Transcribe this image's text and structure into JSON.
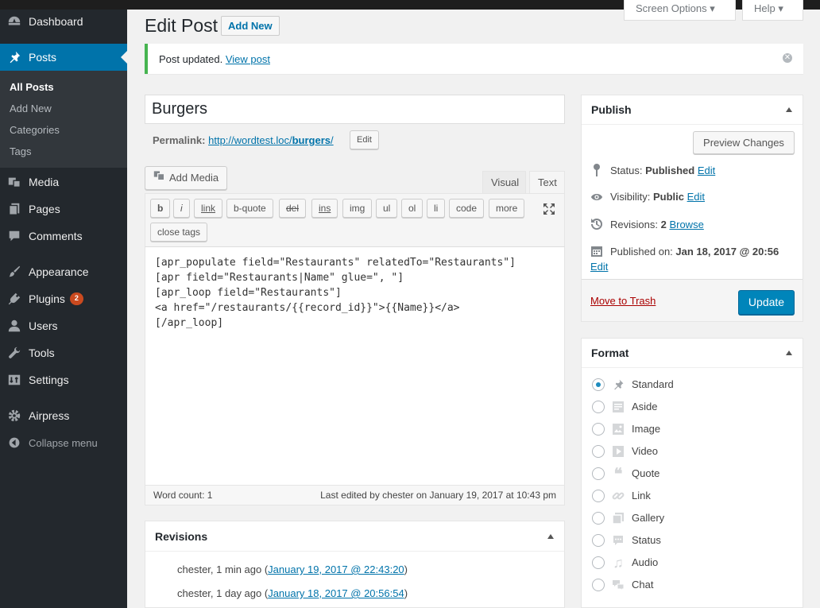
{
  "sidebar": {
    "dashboard": "Dashboard",
    "posts": "Posts",
    "sub": {
      "all_posts": "All Posts",
      "add_new": "Add New",
      "categories": "Categories",
      "tags": "Tags"
    },
    "media": "Media",
    "pages": "Pages",
    "comments": "Comments",
    "appearance": "Appearance",
    "plugins": "Plugins",
    "plugins_badge": "2",
    "users": "Users",
    "tools": "Tools",
    "settings": "Settings",
    "airpress": "Airpress",
    "collapse": "Collapse menu"
  },
  "header": {
    "screen_options": "Screen Options ▾",
    "help": "Help ▾",
    "title": "Edit Post",
    "add_new": "Add New"
  },
  "notice": {
    "text": "Post updated.",
    "link": "View post"
  },
  "post": {
    "title": "Burgers",
    "permalink_label": "Permalink:",
    "permalink_base": "http://wordtest.loc/",
    "permalink_slug": "burgers",
    "permalink_trail": "/",
    "permalink_edit": "Edit"
  },
  "editor": {
    "add_media": "Add Media",
    "tab_visual": "Visual",
    "tab_text": "Text",
    "quicktags": [
      "b",
      "i",
      "link",
      "b-quote",
      "del",
      "ins",
      "img",
      "ul",
      "ol",
      "li",
      "code",
      "more"
    ],
    "close_tags": "close tags",
    "content": "[apr_populate field=\"Restaurants\" relatedTo=\"Restaurants\"]\n[apr field=\"Restaurants|Name\" glue=\", \"]\n[apr_loop field=\"Restaurants\"]\n<a href=\"/restaurants/{{record_id}}\">{{Name}}</a>\n[/apr_loop]",
    "word_count": "Word count: 1",
    "last_edited": "Last edited by chester on January 19, 2017 at 10:43 pm"
  },
  "revisions": {
    "heading": "Revisions",
    "items": [
      {
        "prefix": "chester, 1 min ago (",
        "link": "January 19, 2017 @ 22:43:20",
        "suffix": ")"
      },
      {
        "prefix": "chester, 1 day ago (",
        "link": "January 18, 2017 @ 20:56:54",
        "suffix": ")"
      }
    ]
  },
  "publish": {
    "heading": "Publish",
    "preview": "Preview Changes",
    "status_label": "Status:",
    "status_value": "Published",
    "visibility_label": "Visibility:",
    "visibility_value": "Public",
    "revisions_label": "Revisions:",
    "revisions_value": "2",
    "browse": "Browse",
    "published_label": "Published on:",
    "published_value": "Jan 18, 2017 @ 20:56",
    "edit": "Edit",
    "trash": "Move to Trash",
    "update": "Update"
  },
  "format": {
    "heading": "Format",
    "options": [
      "Standard",
      "Aside",
      "Image",
      "Video",
      "Quote",
      "Link",
      "Gallery",
      "Status",
      "Audio",
      "Chat"
    ],
    "selected": "Standard"
  }
}
